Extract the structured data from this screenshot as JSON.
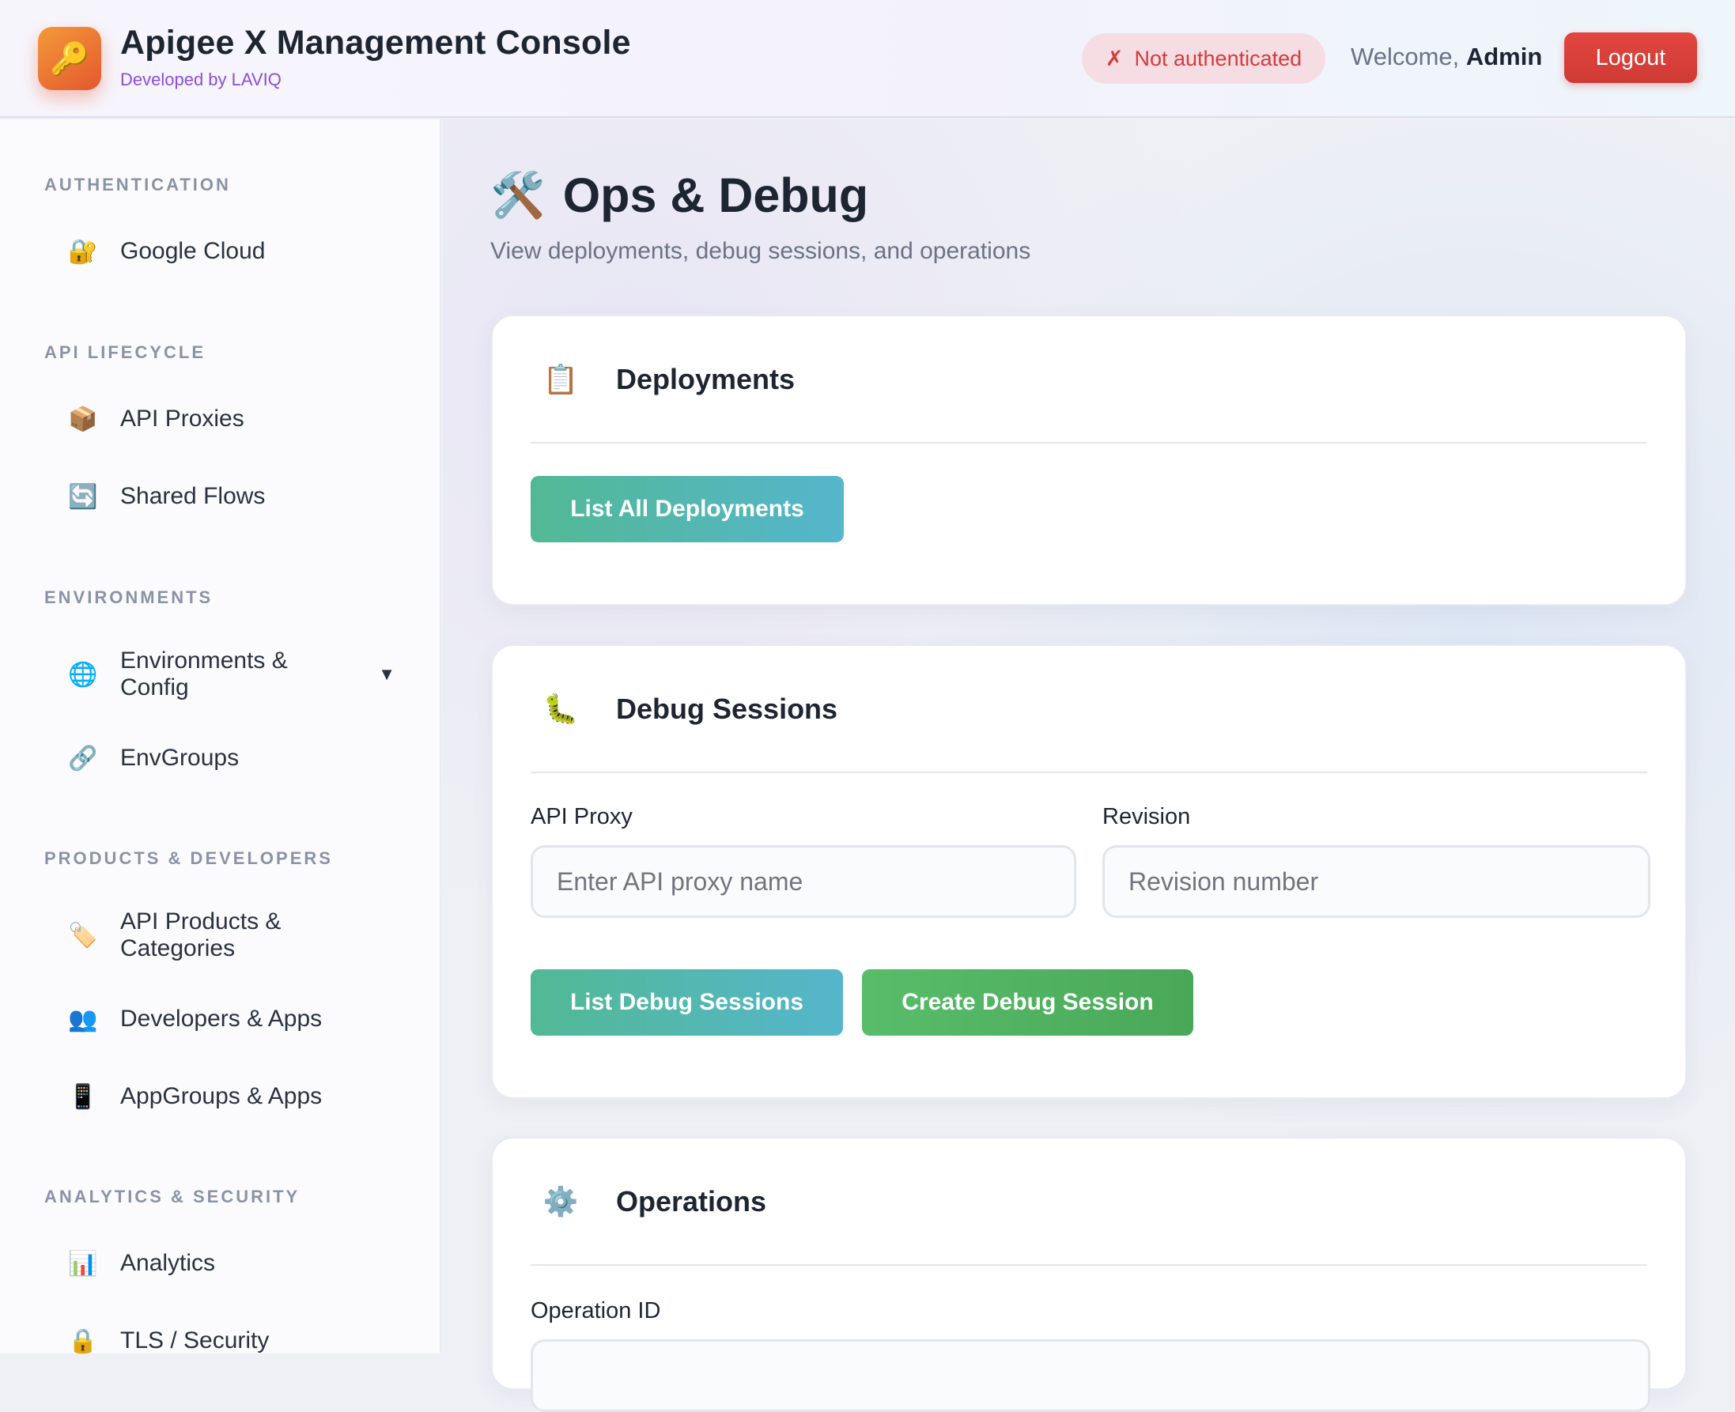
{
  "header": {
    "title": "Apigee X Management Console",
    "subtitle": "Developed by LAVIQ",
    "logo_icon": "🔑",
    "auth_status": {
      "icon": "✗",
      "text": "Not authenticated",
      "color": "#d63b3b"
    },
    "welcome_prefix": "Welcome, ",
    "user_name": "Admin",
    "logout_label": "Logout"
  },
  "sidebar": {
    "sections": [
      {
        "title": "AUTHENTICATION",
        "items": [
          {
            "icon": "🔐",
            "label": "Google Cloud"
          }
        ]
      },
      {
        "title": "API LIFECYCLE",
        "items": [
          {
            "icon": "📦",
            "label": "API Proxies"
          },
          {
            "icon": "🔄",
            "label": "Shared Flows"
          }
        ]
      },
      {
        "title": "ENVIRONMENTS",
        "items": [
          {
            "icon": "🌐",
            "label": "Environments & Config",
            "caret": "▼"
          },
          {
            "icon": "🔗",
            "label": "EnvGroups"
          }
        ]
      },
      {
        "title": "PRODUCTS & DEVELOPERS",
        "items": [
          {
            "icon": "🏷️",
            "label": "API Products & Categories"
          },
          {
            "icon": "👥",
            "label": "Developers & Apps"
          },
          {
            "icon": "📱",
            "label": "AppGroups & Apps"
          }
        ]
      },
      {
        "title": "ANALYTICS & SECURITY",
        "items": [
          {
            "icon": "📊",
            "label": "Analytics"
          },
          {
            "icon": "🔒",
            "label": "TLS / Security"
          }
        ]
      }
    ]
  },
  "main": {
    "page_icon": "🛠️",
    "page_title": "Ops & Debug",
    "page_subtitle": "View deployments, debug sessions, and operations",
    "deployments": {
      "icon": "📋",
      "title": "Deployments",
      "list_button": "List All Deployments"
    },
    "debug": {
      "icon": "🐛",
      "title": "Debug Sessions",
      "proxy_label": "API Proxy",
      "proxy_placeholder": "Enter API proxy name",
      "proxy_value": "",
      "revision_label": "Revision",
      "revision_placeholder": "Revision number",
      "revision_value": "",
      "list_button": "List Debug Sessions",
      "create_button": "Create Debug Session"
    },
    "operations": {
      "icon": "⚙️",
      "title": "Operations",
      "op_id_label": "Operation ID"
    }
  }
}
